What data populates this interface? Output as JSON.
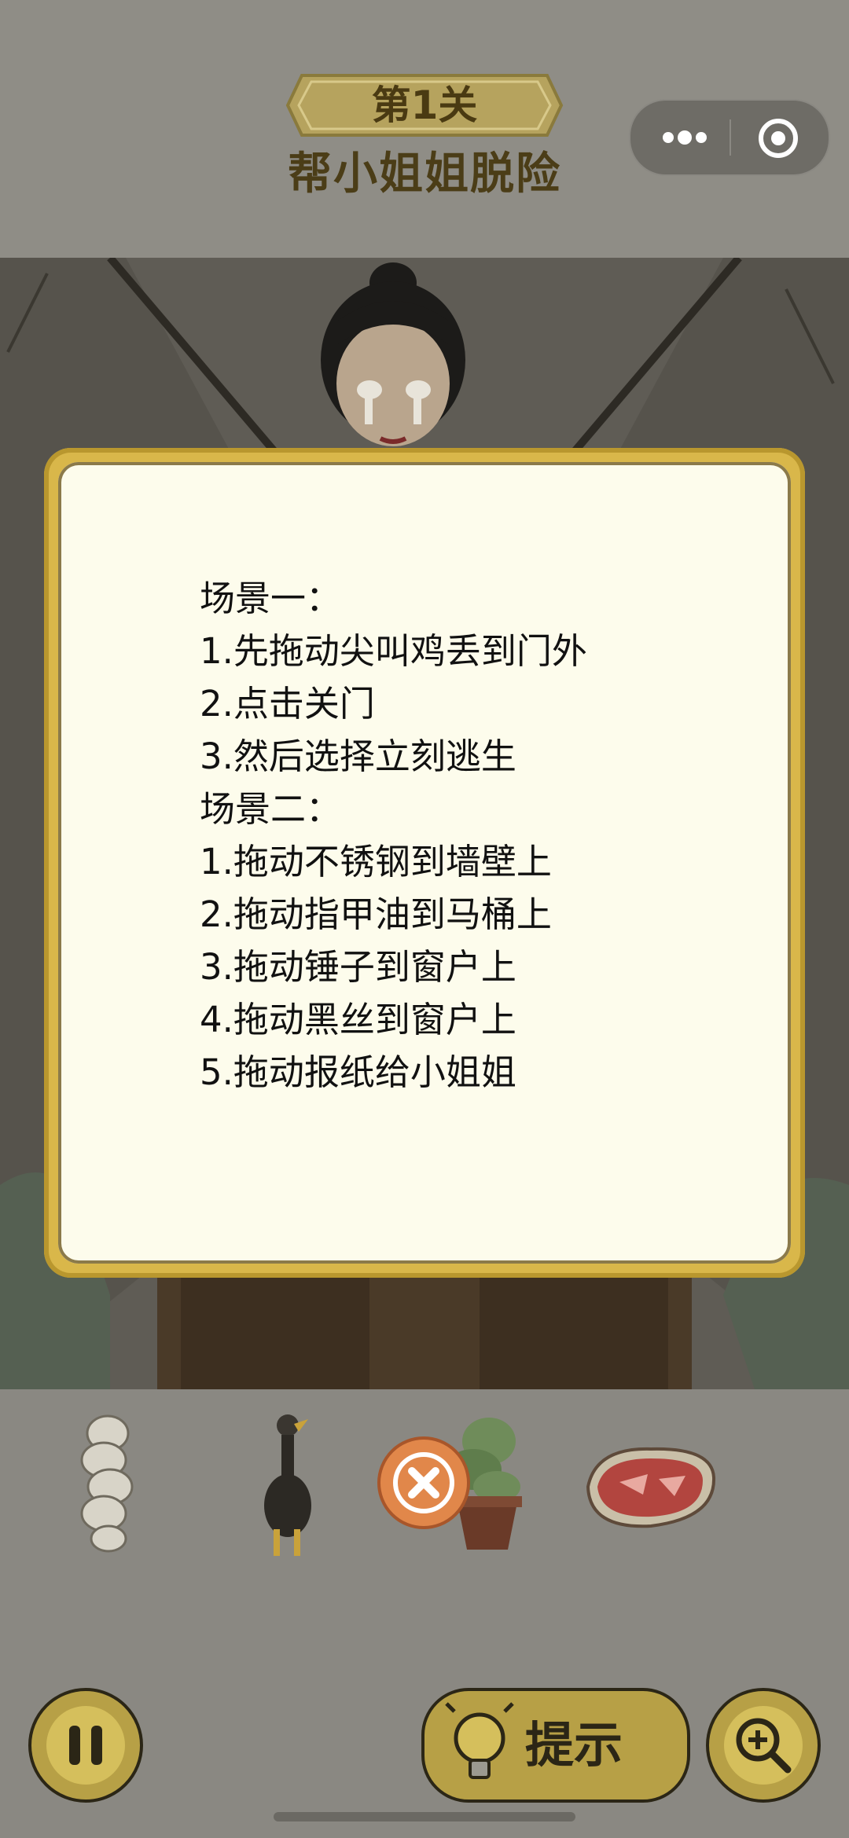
{
  "header": {
    "level_label": "第1关",
    "level_title": "帮小姐姐脱险"
  },
  "capsule": {
    "more_icon": "more-dots-icon",
    "close_icon": "target-circle-icon"
  },
  "popup": {
    "lines": [
      "场景一：",
      "1.先拖动尖叫鸡丢到门外",
      "2.点击关门",
      "3.然后选择立刻逃生",
      "场景二：",
      "1.拖动不锈钢到墙壁上",
      "2.拖动指甲油到马桶上",
      "3.拖动锤子到窗户上",
      "4.拖动黑丝到窗户上",
      "5.拖动报纸给小姐姐"
    ]
  },
  "inventory": {
    "items": [
      "garlic-icon",
      "screaming-chicken-icon",
      "potted-plant-icon",
      "meat-steak-icon"
    ],
    "close_icon": "close-x-icon"
  },
  "toolbar": {
    "pause_icon": "pause-icon",
    "hint_label": "提示",
    "hint_icon": "lightbulb-icon",
    "zoom_icon": "zoom-in-icon"
  },
  "colors": {
    "popup_border": "#d9b74a",
    "popup_fill": "#fdfcec",
    "button_fill": "#b7a046",
    "close_button": "#e1874a"
  }
}
